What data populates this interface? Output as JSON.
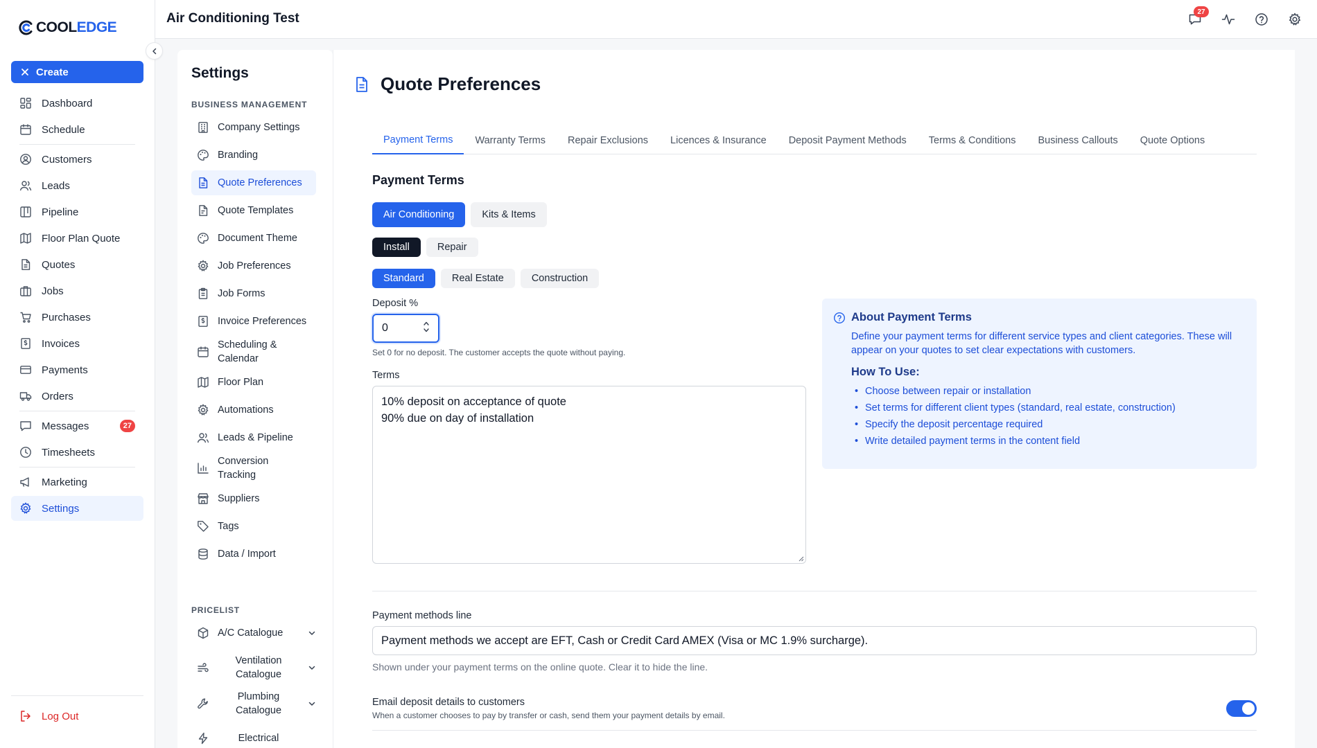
{
  "app": {
    "brand_cool": "COOL",
    "brand_edge": "EDGE",
    "window_title": "Air Conditioning Test",
    "create_label": "Create",
    "logout_label": "Log Out",
    "notifications_count": "27"
  },
  "nav": {
    "items": [
      {
        "label": "Dashboard",
        "icon": "dashboard-icon"
      },
      {
        "label": "Schedule",
        "icon": "calendar-icon"
      },
      {
        "label": "Customers",
        "icon": "user-circle-icon"
      },
      {
        "label": "Leads",
        "icon": "users-icon"
      },
      {
        "label": "Pipeline",
        "icon": "pipeline-icon"
      },
      {
        "label": "Floor Plan Quote",
        "icon": "map-icon"
      },
      {
        "label": "Quotes",
        "icon": "document-icon"
      },
      {
        "label": "Jobs",
        "icon": "briefcase-icon"
      },
      {
        "label": "Purchases",
        "icon": "cart-icon"
      },
      {
        "label": "Invoices",
        "icon": "invoice-icon"
      },
      {
        "label": "Payments",
        "icon": "credit-card-icon"
      },
      {
        "label": "Orders",
        "icon": "truck-icon"
      },
      {
        "label": "Messages",
        "icon": "message-icon",
        "badge": "27"
      },
      {
        "label": "Timesheets",
        "icon": "clock-icon"
      },
      {
        "label": "Marketing",
        "icon": "megaphone-icon"
      },
      {
        "label": "Settings",
        "icon": "gear-icon"
      }
    ]
  },
  "settings": {
    "title": "Settings",
    "business_management_label": "BUSINESS MANAGEMENT",
    "items": [
      {
        "label": "Company Settings"
      },
      {
        "label": "Branding"
      },
      {
        "label": "Quote Preferences"
      },
      {
        "label": "Quote Templates"
      },
      {
        "label": "Document Theme"
      },
      {
        "label": "Job Preferences"
      },
      {
        "label": "Job Forms"
      },
      {
        "label": "Invoice Preferences"
      },
      {
        "label": "Scheduling & Calendar"
      },
      {
        "label": "Floor Plan"
      },
      {
        "label": "Automations"
      },
      {
        "label": "Leads & Pipeline"
      },
      {
        "label": "Conversion Tracking"
      },
      {
        "label": "Suppliers"
      },
      {
        "label": "Tags"
      },
      {
        "label": "Data / Import"
      }
    ],
    "pricelist_label": "PRICELIST",
    "pricelist_items": [
      {
        "label": "A/C Catalogue"
      },
      {
        "label": "Ventilation Catalogue"
      },
      {
        "label": "Plumbing Catalogue"
      },
      {
        "label": "Electrical"
      }
    ]
  },
  "main": {
    "page_title": "Quote Preferences",
    "tabs": [
      {
        "label": "Payment Terms"
      },
      {
        "label": "Warranty Terms"
      },
      {
        "label": "Repair Exclusions"
      },
      {
        "label": "Licences & Insurance"
      },
      {
        "label": "Deposit Payment Methods"
      },
      {
        "label": "Terms & Conditions"
      },
      {
        "label": "Business Callouts"
      },
      {
        "label": "Quote Options"
      }
    ],
    "section_title": "Payment Terms",
    "category_options": [
      "Air Conditioning",
      "Kits & Items"
    ],
    "job_type_options": [
      "Install",
      "Repair"
    ],
    "client_type_options": [
      "Standard",
      "Real Estate",
      "Construction"
    ],
    "deposit_label": "Deposit %",
    "deposit_value": "0",
    "deposit_help": "Set 0 for no deposit. The customer accepts the quote without paying.",
    "terms_label": "Terms",
    "terms_lines": [
      "10% deposit on acceptance of quote",
      "90% due on day of installation"
    ],
    "info": {
      "title": "About Payment Terms",
      "description": "Define your payment terms for different service types and client categories. These will appear on your quotes to set clear expectations with customers.",
      "how_to_title": "How To Use:",
      "steps": [
        "Choose between repair or installation",
        "Set terms for different client types (standard, real estate, construction)",
        "Specify the deposit percentage required",
        "Write detailed payment terms in the content field"
      ]
    },
    "payment_methods_label": "Payment methods line",
    "payment_methods_value": "Payment methods we accept are EFT, Cash or Credit Card AMEX (Visa or MC 1.9% surcharge).",
    "payment_methods_help": "Shown under your payment terms on the online quote. Clear it to hide the line.",
    "email_deposit_title": "Email deposit details to customers",
    "email_deposit_help": "When a customer chooses to pay by transfer or cash, send them your payment details by email.",
    "email_deposit_enabled": true
  },
  "colors": {
    "accent": "#2563eb",
    "badge": "#ef4444",
    "active_bg": "#eef4ff"
  }
}
